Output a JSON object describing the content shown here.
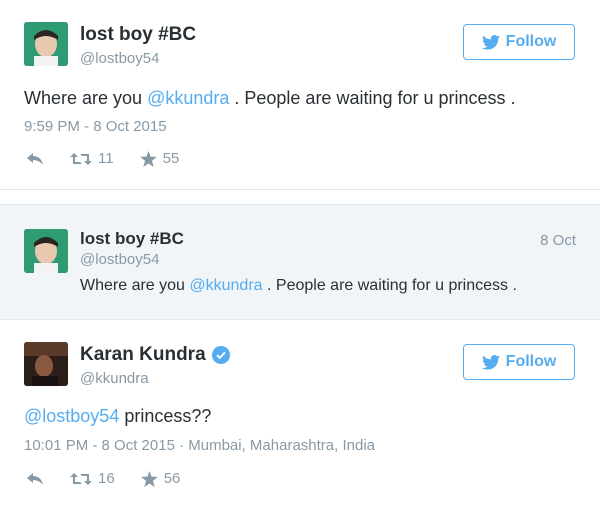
{
  "tweet1": {
    "name": "lost boy #BC",
    "handle": "@lostboy54",
    "follow_label": "Follow",
    "text_before": "Where are you ",
    "mention": "@kkundra",
    "text_after": " . People are waiting for u princess .",
    "timestamp": "9:59 PM - 8 Oct 2015",
    "retweets": "11",
    "favorites": "55"
  },
  "tweet2": {
    "name": "lost boy #BC",
    "handle": "@lostboy54",
    "date": "8 Oct",
    "text_before": "Where are you ",
    "mention": "@kkundra",
    "text_after": " . People are waiting for u princess ."
  },
  "tweet3": {
    "name": "Karan Kundra",
    "handle": "@kkundra",
    "follow_label": "Follow",
    "mention": "@lostboy54",
    "text_after": " princess??",
    "timestamp": "10:01 PM - 8 Oct 2015",
    "location": " · Mumbai, Maharashtra, India",
    "retweets": "16",
    "favorites": "56"
  },
  "colors": {
    "accent": "#55acee",
    "muted": "#8899a6",
    "text": "#292f33",
    "quoted_bg": "#f1f5f8"
  }
}
